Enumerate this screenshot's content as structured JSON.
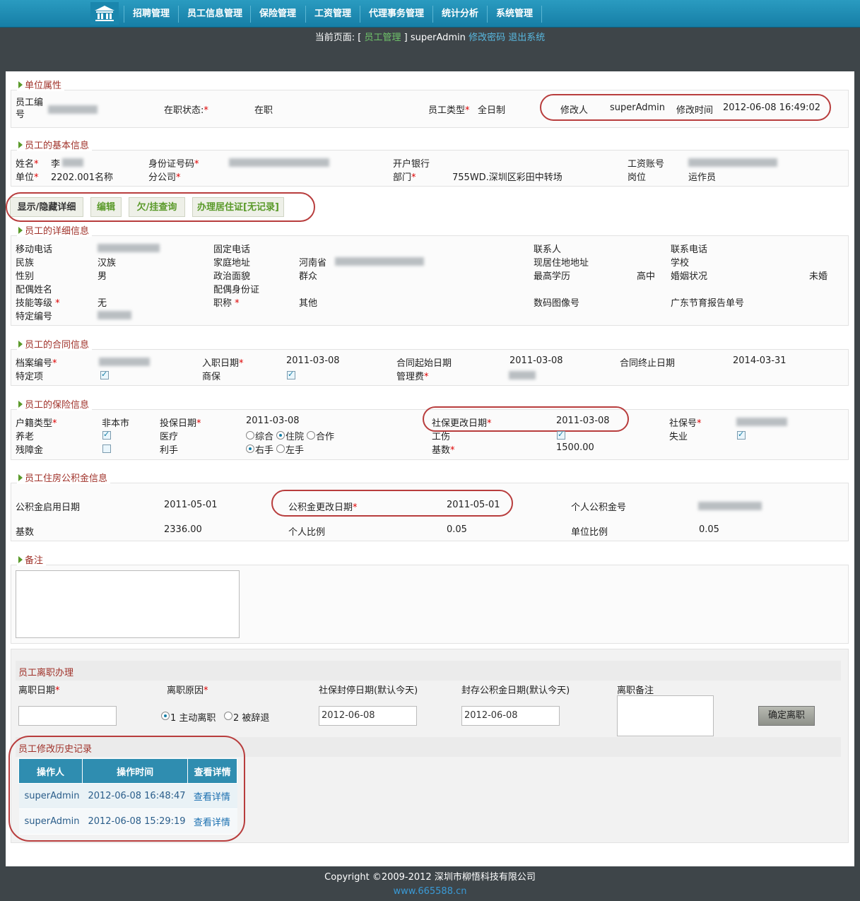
{
  "nav": {
    "items": [
      "招聘管理",
      "员工信息管理",
      "保险管理",
      "工资管理",
      "代理事务管理",
      "统计分析",
      "系统管理"
    ]
  },
  "breadcrumb": {
    "prefix": "当前页面: [",
    "page": "员工管理",
    "suffix": "]",
    "user": "superAdmin",
    "change_pwd": "修改密码",
    "logout": "退出系统"
  },
  "unit": {
    "title": "单位属性",
    "emp_no_label": "员工编号",
    "status_label": "在职状态:",
    "status_value": "在职",
    "type_label": "员工类型",
    "type_value": "全日制",
    "modifier_label": "修改人",
    "modifier_value": "superAdmin",
    "mod_time_label": "修改时间",
    "mod_time_value": "2012-06-08 16:49:02"
  },
  "basic": {
    "title": "员工的基本信息",
    "name_label": "姓名",
    "name_value": "李",
    "id_label": "身份证号码",
    "bank_label": "开户银行",
    "payacct_label": "工资账号",
    "unit_label": "单位",
    "unit_value": "2202.001名称",
    "branch_label": "分公司",
    "dept_label": "部门",
    "dept_value": "755WD.深圳区彩田中转场",
    "post_label": "岗位",
    "post_value": "运作员"
  },
  "buttons": {
    "toggle": "显示/隐藏详细",
    "edit": "编辑",
    "query": "欠/挂查询",
    "permit": "办理居住证[无记录]"
  },
  "detail": {
    "title": "员工的详细信息",
    "mobile": "移动电话",
    "phone": "固定电话",
    "contact": "联系人",
    "contact_phone": "联系电话",
    "nation": "民族",
    "nation_value": "汉族",
    "home_addr": "家庭地址",
    "home_addr_value": "河南省",
    "cur_addr": "现居住地地址",
    "school": "学校",
    "gender": "性别",
    "gender_value": "男",
    "politics": "政治面貌",
    "politics_value": "群众",
    "edu": "最高学历",
    "edu_value": "高中",
    "marriage": "婚姻状况",
    "marriage_value": "未婚",
    "spouse": "配偶姓名",
    "spouse_id": "配偶身份证",
    "skill": "技能等级",
    "skill_value": "无",
    "title_label": "职称",
    "title_value": "其他",
    "photo": "数码图像号",
    "gd_report": "广东节育报告单号",
    "special_no": "特定编号"
  },
  "contract": {
    "title": "员工的合同信息",
    "file_no": "档案编号",
    "entry": "入职日期",
    "entry_value": "2011-03-08",
    "start": "合同起始日期",
    "start_value": "2011-03-08",
    "end": "合同终止日期",
    "end_value": "2014-03-31",
    "special": "特定项",
    "biz_ins": "商保",
    "fee": "管理费"
  },
  "insurance": {
    "title": "员工的保险信息",
    "household": "户籍类型",
    "household_value": "非本市",
    "ins_date": "投保日期",
    "ins_date_value": "2011-03-08",
    "change_date": "社保更改日期",
    "change_date_value": "2011-03-08",
    "ss_no": "社保号",
    "pension": "养老",
    "medical": "医疗",
    "med_opt1": "综合",
    "med_opt2": "住院",
    "med_opt3": "合作",
    "injury": "工伤",
    "unemploy": "失业",
    "disability": "残障金",
    "hand": "利手",
    "hand_opt1": "右手",
    "hand_opt2": "左手",
    "base": "基数",
    "base_value": "1500.00"
  },
  "fund": {
    "title": "员工住房公积金信息",
    "start": "公积金启用日期",
    "start_value": "2011-05-01",
    "change": "公积金更改日期",
    "change_value": "2011-05-01",
    "personal_no": "个人公积金号",
    "base": "基数",
    "base_value": "2336.00",
    "personal_ratio": "个人比例",
    "personal_ratio_value": "0.05",
    "unit_ratio": "单位比例",
    "unit_ratio_value": "0.05"
  },
  "remark": {
    "title": "备注"
  },
  "leave": {
    "title": "员工离职办理",
    "date": "离职日期",
    "reason": "离职原因",
    "reason_opt1": "1 主动离职",
    "reason_opt2": "2 被辞退",
    "ss_stop": "社保封停日期(默认今天)",
    "ss_stop_value": "2012-06-08",
    "fund_seal": "封存公积金日期(默认今天)",
    "fund_seal_value": "2012-06-08",
    "note": "离职备注",
    "confirm": "确定离职"
  },
  "history": {
    "title": "员工修改历史记录",
    "headers": [
      "操作人",
      "操作时间",
      "查看详情"
    ],
    "rows": [
      [
        "superAdmin",
        "2012-06-08 16:48:47",
        "查看详情"
      ],
      [
        "superAdmin",
        "2012-06-08 15:29:19",
        "查看详情"
      ]
    ]
  },
  "footer": {
    "copyright": "Copyright ©2009-2012 深圳市柳悟科技有限公司",
    "site": "www.665588.cn"
  }
}
